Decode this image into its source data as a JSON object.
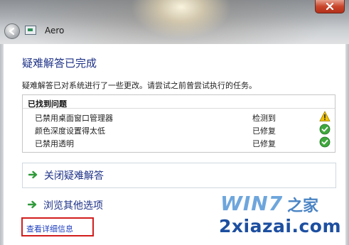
{
  "window": {
    "title": "Aero",
    "close_icon": "close-icon",
    "back_icon": "back-arrow-icon"
  },
  "main": {
    "heading": "疑难解答已完成",
    "description": "疑难解答已对系统进行了一些更改。请尝试之前曾尝试执行的任务。"
  },
  "issues": {
    "header": "已找到问题",
    "rows": [
      {
        "name": "已禁用桌面窗口管理器",
        "status": "检测到",
        "icon": "warning-icon"
      },
      {
        "name": "颜色深度设置得太低",
        "status": "已修复",
        "icon": "check-icon"
      },
      {
        "name": "已禁用透明",
        "status": "已修复",
        "icon": "check-icon"
      }
    ]
  },
  "actions": {
    "close_label": "关闭疑难解答",
    "explore_label": "浏览其他选项"
  },
  "details_link": "查看详细信息",
  "watermark": {
    "brand": "WIN7",
    "brand_suffix": "之家",
    "site": "2xiazai.com"
  },
  "colors": {
    "accent": "#1e3287",
    "link": "#1e3fbf",
    "warning": "#f2c200",
    "ok": "#3ea83c",
    "highlight_box": "#d21d1d"
  }
}
